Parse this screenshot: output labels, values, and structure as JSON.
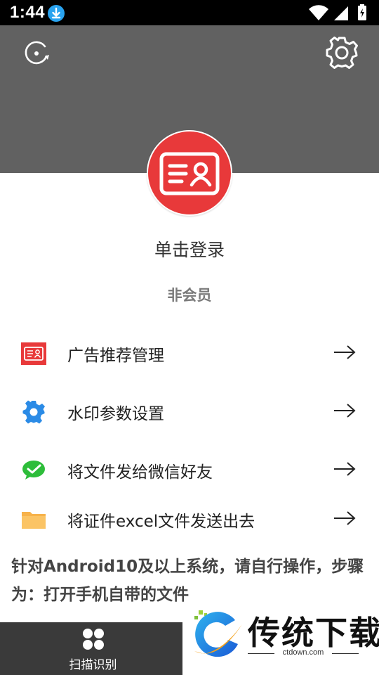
{
  "status_bar": {
    "time": "1:44"
  },
  "header": {
    "rotate_icon": "rotate-icon",
    "settings_icon": "gear-icon",
    "bg_color": "#616161"
  },
  "profile": {
    "avatar_icon": "id-card-icon",
    "avatar_color": "#e8393a",
    "login_label": "单击登录",
    "membership": "非会员"
  },
  "menu": [
    {
      "icon": "id-card-icon",
      "label": "广告推荐管理"
    },
    {
      "icon": "gear-icon",
      "label": "水印参数设置"
    },
    {
      "icon": "wechat-icon",
      "label": "将文件发给微信好友"
    },
    {
      "icon": "folder-icon",
      "label": "将证件excel文件发送出去"
    }
  ],
  "notice": "针对Android10及以上系统，请自行操作，步骤为：打开手机自带的文件",
  "bottom_nav": {
    "label": "扫描识别",
    "icon": "scan-icon"
  },
  "watermark": {
    "title": "传统下载",
    "url": "ctdown.com"
  }
}
